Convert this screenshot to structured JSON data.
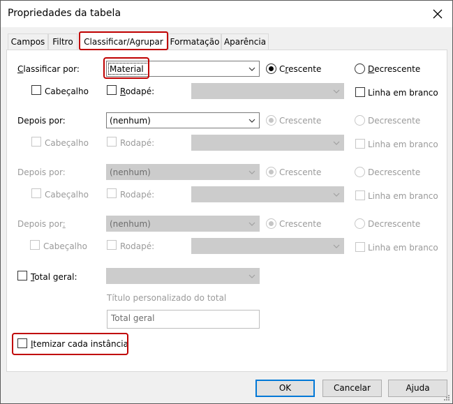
{
  "dialog": {
    "title": "Propriedades da tabela"
  },
  "tabs": [
    {
      "label": "Campos"
    },
    {
      "label": "Filtro"
    },
    {
      "label": "Classificar/Agrupar"
    },
    {
      "label": "Formatação"
    },
    {
      "label": "Aparência"
    }
  ],
  "sort1": {
    "label": "Classificar por:",
    "value": "Material",
    "asc": "Crescente",
    "desc": "Decrescente",
    "header": "Cabeçalho",
    "footer": "Rodapé:",
    "blank": "Linha em branco"
  },
  "sort2": {
    "label": "Depois por:",
    "value": "(nenhum)",
    "asc": "Crescente",
    "desc": "Decrescente",
    "header": "Cabeçalho",
    "footer": "Rodapé:",
    "blank": "Linha em branco"
  },
  "sort3": {
    "label": "Depois por:",
    "value": "(nenhum)",
    "asc": "Crescente",
    "desc": "Decrescente",
    "header": "Cabeçalho",
    "footer": "Rodapé:",
    "blank": "Linha em branco"
  },
  "sort4": {
    "label": "Depois por:",
    "value": "(nenhum)",
    "asc": "Crescente",
    "desc": "Decrescente",
    "header": "Cabeçalho",
    "footer": "Rodapé:",
    "blank": "Linha em branco"
  },
  "total": {
    "label": "Total geral:",
    "title_caption": "Título personalizado do total",
    "title_value": "Total geral"
  },
  "itemize": {
    "label": "Itemizar cada instância"
  },
  "buttons": {
    "ok": "OK",
    "cancel": "Cancelar",
    "help": "Ajuda"
  },
  "colors": {
    "highlight": "#c00000",
    "default_button_border": "#0078d7"
  }
}
